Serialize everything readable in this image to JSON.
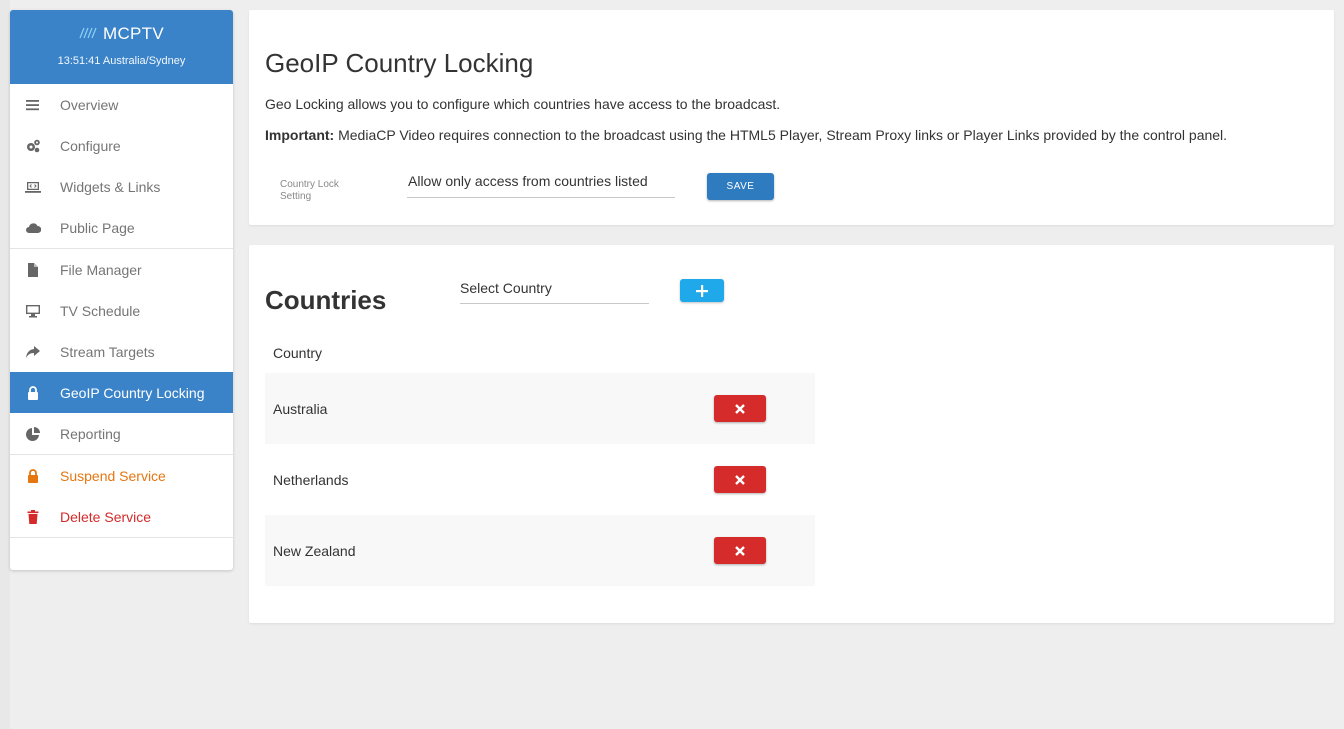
{
  "sidebar": {
    "brand": "MCPTV",
    "clock": "13:51:41 Australia/Sydney",
    "groups": [
      [
        {
          "label": "Overview",
          "icon": "list-icon"
        },
        {
          "label": "Configure",
          "icon": "gears-icon"
        },
        {
          "label": "Widgets & Links",
          "icon": "laptop-code-icon"
        },
        {
          "label": "Public Page",
          "icon": "cloud-icon"
        }
      ],
      [
        {
          "label": "File Manager",
          "icon": "file-icon"
        },
        {
          "label": "TV Schedule",
          "icon": "desktop-icon"
        },
        {
          "label": "Stream Targets",
          "icon": "share-icon"
        },
        {
          "label": "GeoIP Country Locking",
          "icon": "lock-icon",
          "active": true
        },
        {
          "label": "Reporting",
          "icon": "pie-chart-icon"
        }
      ],
      [
        {
          "label": "Suspend Service",
          "icon": "lock-icon",
          "color": "#e57610"
        },
        {
          "label": "Delete Service",
          "icon": "trash-icon",
          "color": "#d42a2a"
        }
      ]
    ]
  },
  "geo": {
    "title": "GeoIP Country Locking",
    "intro": "Geo Locking allows you to configure which countries have access to the broadcast.",
    "important_label": "Important:",
    "important_text": " MediaCP Video requires connection to the broadcast using the HTML5 Player, Stream Proxy links or Player Links provided by the control panel.",
    "lock_label": "Country Lock Setting",
    "lock_value": "Allow only access from countries listed",
    "save_label": "SAVE"
  },
  "countries": {
    "title": "Countries",
    "select_placeholder": "Select Country",
    "column_header": "Country",
    "rows": [
      "Australia",
      "Netherlands",
      "New Zealand"
    ]
  },
  "colors": {
    "primary": "#3a83c8",
    "add_button": "#1fa8ea",
    "delete_button": "#d52b2b",
    "suspend": "#e57610"
  }
}
